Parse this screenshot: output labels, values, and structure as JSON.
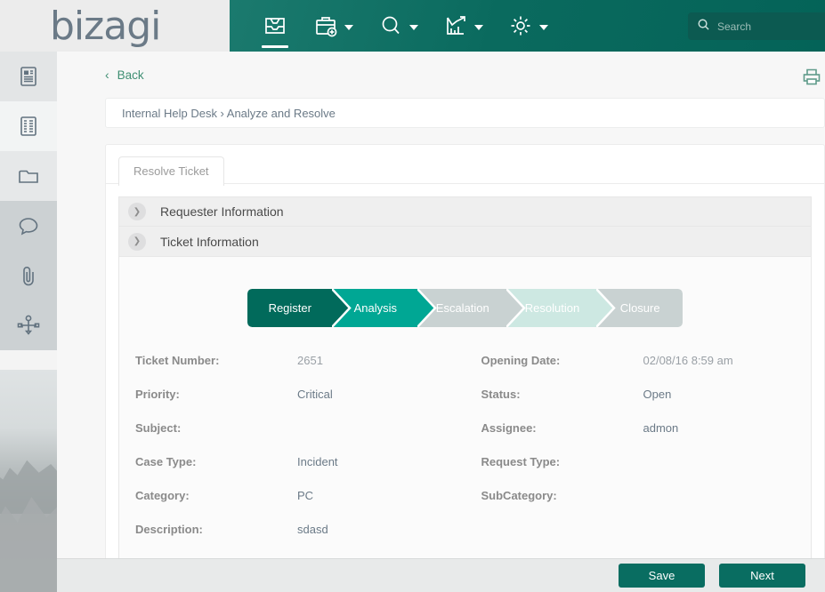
{
  "brand": {
    "logo_text": "bizagi",
    "accent_teal": "#046358",
    "accent_light_teal": "#00a794",
    "link_green": "#3f8f73"
  },
  "topbar": {
    "nav": [
      {
        "icon": "inbox-icon",
        "label": "Inbox",
        "active": true,
        "has_caret": false
      },
      {
        "icon": "new-case-icon",
        "label": "New Case",
        "active": false,
        "has_caret": true
      },
      {
        "icon": "search-icon",
        "label": "Search",
        "active": false,
        "has_caret": true
      },
      {
        "icon": "analytics-icon",
        "label": "Analytics",
        "active": false,
        "has_caret": true
      },
      {
        "icon": "gear-icon",
        "label": "Admin",
        "active": false,
        "has_caret": true
      }
    ],
    "search": {
      "placeholder": "Search",
      "value": ""
    }
  },
  "sidebar": {
    "toggle_icon": "chevron-right-icon",
    "items": [
      {
        "icon": "news-icon",
        "label": "News"
      },
      {
        "icon": "form-icon",
        "label": "Form"
      },
      {
        "icon": "folder-icon",
        "label": "Documents"
      },
      {
        "icon": "comment-icon",
        "label": "Comments"
      },
      {
        "icon": "paperclip-icon",
        "label": "Attachments"
      },
      {
        "icon": "process-diagram-icon",
        "label": "Process"
      }
    ]
  },
  "main": {
    "back_label": "Back",
    "print_icon": "printer-icon",
    "breadcrumb": "Internal Help Desk › Analyze and Resolve",
    "tabs": [
      {
        "label": "Resolve Ticket",
        "active": true
      }
    ],
    "sections": [
      {
        "title": "Requester Information",
        "expanded": false,
        "chevron": "chevron-right-icon"
      },
      {
        "title": "Ticket Information",
        "expanded": true,
        "chevron": "chevron-down-icon"
      }
    ],
    "stepper": [
      {
        "label": "Register",
        "state": "completed",
        "color": "#016a5b"
      },
      {
        "label": "Analysis",
        "state": "active",
        "color": "#00a794"
      },
      {
        "label": "Escalation",
        "state": "pending",
        "color": "#c9d2d2"
      },
      {
        "label": "Resolution",
        "state": "pending",
        "color": "#cde8e2"
      },
      {
        "label": "Closure",
        "state": "pending",
        "color": "#c9d2d2"
      }
    ],
    "fields": [
      {
        "left_label": "Ticket Number:",
        "left_value": "2651",
        "left_muted": true,
        "right_label": "Opening Date:",
        "right_value": "02/08/16 8:59 am",
        "right_muted": true
      },
      {
        "left_label": "Priority:",
        "left_value": "Critical",
        "left_muted": false,
        "right_label": "Status:",
        "right_value": "Open",
        "right_muted": false
      },
      {
        "left_label": "Subject:",
        "left_value": "",
        "left_muted": false,
        "right_label": "Assignee:",
        "right_value": "admon",
        "right_muted": false
      },
      {
        "left_label": "Case Type:",
        "left_value": "Incident",
        "left_muted": false,
        "right_label": "Request Type:",
        "right_value": "",
        "right_muted": false
      },
      {
        "left_label": "Category:",
        "left_value": "PC",
        "left_muted": false,
        "right_label": "SubCategory:",
        "right_value": "",
        "right_muted": false
      },
      {
        "left_label": "Description:",
        "left_value": "sdasd",
        "left_muted": false,
        "right_label": "",
        "right_value": "",
        "right_muted": false
      }
    ]
  },
  "actionbar": {
    "save_label": "Save",
    "next_label": "Next"
  }
}
